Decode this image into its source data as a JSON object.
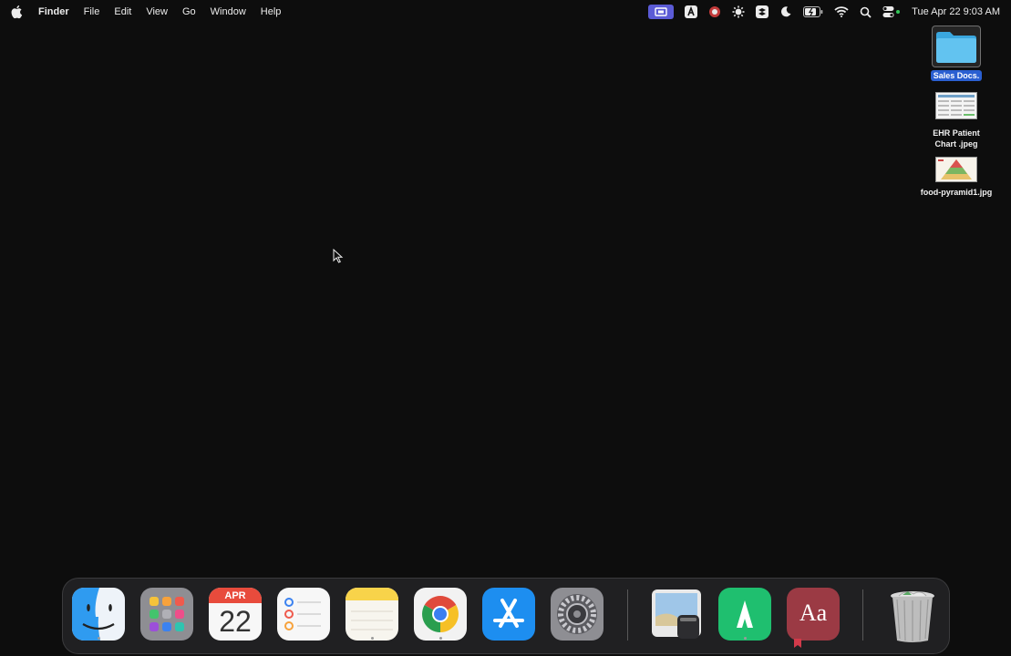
{
  "menubar": {
    "app_name": "Finder",
    "menus": [
      "File",
      "Edit",
      "View",
      "Go",
      "Window",
      "Help"
    ],
    "status_icons": [
      "screen-record-icon",
      "a-app-icon",
      "record-icon",
      "sun-gear-icon",
      "stack-icon",
      "moon-icon",
      "battery-icon",
      "wifi-icon",
      "search-icon",
      "control-center-icon"
    ],
    "clock": "Tue Apr 22  9:03 AM"
  },
  "desktop": {
    "items": [
      {
        "label": "Sales Docs.",
        "type": "folder",
        "selected": true
      },
      {
        "label": "EHR Patient\nChart .jpeg",
        "type": "image"
      },
      {
        "label": "food-pyramid1.jpg",
        "type": "image"
      }
    ]
  },
  "dock": {
    "apps": [
      "Finder",
      "Launchpad",
      "Calendar",
      "Reminders",
      "Notes",
      "Google Chrome",
      "App Store",
      "System Settings",
      "Preview",
      "Anytype",
      "Dictionary",
      "Trash"
    ],
    "calendar": {
      "month": "APR",
      "day": "22"
    },
    "dictionary_glyph": "Aa",
    "running": [
      "Finder",
      "Notes",
      "Google Chrome",
      "Anytype"
    ]
  },
  "colors": {
    "desktop_bg": "#0d0d0d",
    "selection_blue": "#2a5fd1",
    "screen_record_purple": "#5b5bd6"
  }
}
